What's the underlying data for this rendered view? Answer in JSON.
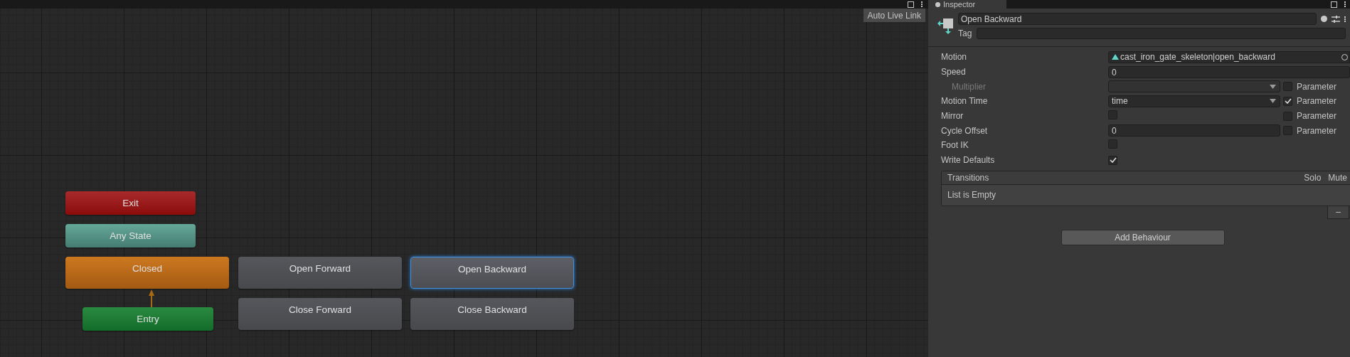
{
  "graph": {
    "toolbar_button": "Auto Live Link",
    "nodes": [
      {
        "label": "Exit",
        "kind": "exit",
        "selected": false
      },
      {
        "label": "Any State",
        "kind": "any",
        "selected": false
      },
      {
        "label": "Closed",
        "kind": "default",
        "selected": false
      },
      {
        "label": "Open Forward",
        "kind": "state",
        "selected": false
      },
      {
        "label": "Open Backward",
        "kind": "state",
        "selected": true
      },
      {
        "label": "Close Forward",
        "kind": "state",
        "selected": false
      },
      {
        "label": "Close Backward",
        "kind": "state",
        "selected": false
      },
      {
        "label": "Entry",
        "kind": "entry",
        "selected": false
      }
    ]
  },
  "inspector": {
    "tab": "Inspector",
    "name": "Open Backward",
    "tag_label": "Tag",
    "properties": [
      {
        "label": "Motion",
        "kind": "object",
        "value": "cast_iron_gate_skeleton|open_backward",
        "disabled": false
      },
      {
        "label": "Speed",
        "kind": "number",
        "value": "0",
        "disabled": false
      },
      {
        "label": "Multiplier",
        "kind": "dropdown",
        "disabled": true,
        "parameter": {
          "label": "Parameter",
          "checked": false
        }
      },
      {
        "label": "Motion Time",
        "kind": "dropdown",
        "value": "time",
        "disabled": false,
        "parameter": {
          "label": "Parameter",
          "checked": true
        }
      },
      {
        "label": "Mirror",
        "kind": "checkbox",
        "checked": false,
        "disabled": false,
        "parameter": {
          "label": "Parameter",
          "checked": false
        }
      },
      {
        "label": "Cycle Offset",
        "kind": "number",
        "value": "0",
        "disabled": false,
        "parameter": {
          "label": "Parameter",
          "checked": false
        }
      },
      {
        "label": "Foot IK",
        "kind": "checkbox",
        "checked": false,
        "disabled": false
      },
      {
        "label": "Write Defaults",
        "kind": "checkbox",
        "checked": true,
        "disabled": false
      }
    ],
    "transitions_list": {
      "title": "Transitions",
      "columns": [
        "Solo",
        "Mute"
      ],
      "empty_text": "List is Empty",
      "remove_button": "–"
    },
    "add_button": "Add Behaviour"
  }
}
